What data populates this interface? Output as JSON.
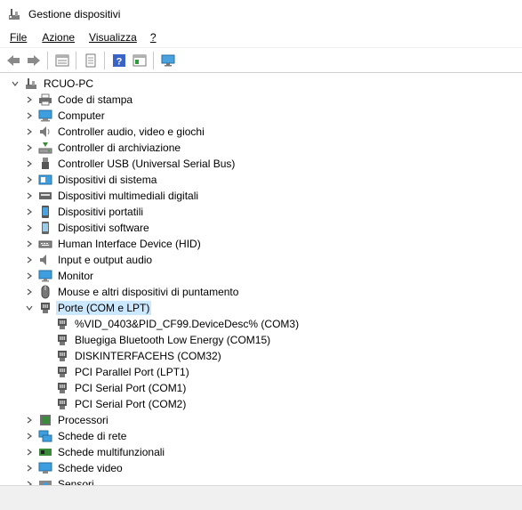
{
  "window": {
    "title": "Gestione dispositivi"
  },
  "menu": [
    {
      "label": "File"
    },
    {
      "label": "Azione"
    },
    {
      "label": "Visualizza"
    },
    {
      "label": "?"
    }
  ],
  "tree": {
    "root": "RCUO-PC",
    "categories": [
      {
        "label": "Code di stampa",
        "icon": "printer-icon"
      },
      {
        "label": "Computer",
        "icon": "computer-icon"
      },
      {
        "label": "Controller audio, video e giochi",
        "icon": "speaker-icon"
      },
      {
        "label": "Controller di archiviazione",
        "icon": "storage-icon"
      },
      {
        "label": "Controller USB (Universal Serial Bus)",
        "icon": "usb-icon"
      },
      {
        "label": "Dispositivi di sistema",
        "icon": "system-icon"
      },
      {
        "label": "Dispositivi multimediali digitali",
        "icon": "media-icon"
      },
      {
        "label": "Dispositivi portatili",
        "icon": "portable-icon"
      },
      {
        "label": "Dispositivi software",
        "icon": "software-icon"
      },
      {
        "label": "Human Interface Device (HID)",
        "icon": "hid-icon"
      },
      {
        "label": "Input e output audio",
        "icon": "audio-io-icon"
      },
      {
        "label": "Monitor",
        "icon": "monitor-icon"
      },
      {
        "label": "Mouse e altri dispositivi di puntamento",
        "icon": "mouse-icon"
      },
      {
        "label": "Porte (COM e LPT)",
        "icon": "port-icon",
        "expanded": true,
        "selected": true,
        "children": [
          {
            "label": "%VID_0403&PID_CF99.DeviceDesc% (COM3)"
          },
          {
            "label": "Bluegiga Bluetooth Low Energy (COM15)"
          },
          {
            "label": "DISKINTERFACEHS (COM32)"
          },
          {
            "label": "PCI Parallel Port (LPT1)"
          },
          {
            "label": "PCI Serial Port (COM1)"
          },
          {
            "label": "PCI Serial Port (COM2)"
          }
        ]
      },
      {
        "label": "Processori",
        "icon": "processor-icon"
      },
      {
        "label": "Schede di rete",
        "icon": "network-icon"
      },
      {
        "label": "Schede multifunzionali",
        "icon": "multifunction-icon"
      },
      {
        "label": "Schede video",
        "icon": "display-adapter-icon"
      },
      {
        "label": "Sensori",
        "icon": "sensor-icon"
      }
    ]
  }
}
